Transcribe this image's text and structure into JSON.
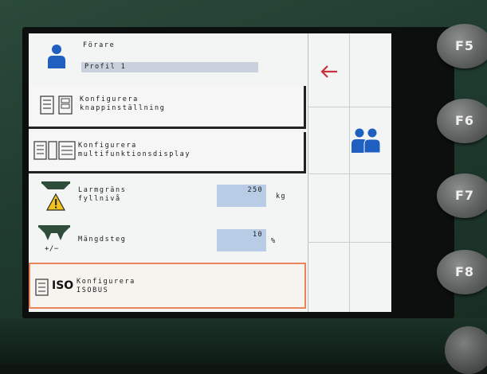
{
  "header": {
    "driver_label": "Förare",
    "profile_value": "Profil 1"
  },
  "menu": {
    "keypad_config": {
      "line1": "Konfigurera",
      "line2": "knappinställning"
    },
    "multidisplay_config": {
      "line1": "Konfigurera",
      "line2": "multifunktionsdisplay"
    },
    "alarm_fill": {
      "line1": "Larmgräns",
      "line2": "fyllnivå",
      "value": "250",
      "unit": "kg"
    },
    "quantity_step": {
      "label": "Mängdsteg",
      "value": "10",
      "unit": "%",
      "icon_text": "+/−"
    },
    "isobus_config": {
      "iso_text": "ISO",
      "line1": "Konfigurera",
      "line2": "ISOBUS"
    }
  },
  "softkeys": {
    "back_icon": "arrow-left-icon",
    "profiles_icon": "users-icon"
  },
  "hardkeys": [
    "F5",
    "F6",
    "F7",
    "F8"
  ],
  "colors": {
    "field_bg": "#b9cce6",
    "user_icon_blue": "#1f5fbf",
    "selection_border": "#e8835a",
    "back_arrow": "#c8323c"
  }
}
